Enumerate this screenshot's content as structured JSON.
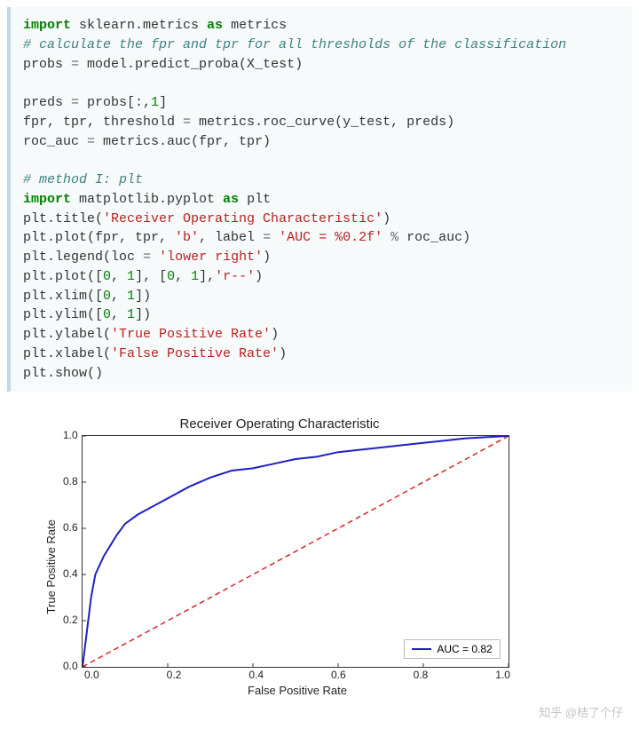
{
  "code": {
    "l1_kw": "import",
    "l1_rest": " sklearn.metrics ",
    "l1_as": "as",
    "l1_alias": " metrics",
    "l2": "# calculate the fpr and tpr for all thresholds of the classification",
    "l3a": "probs ",
    "l3op": "=",
    "l3b": " model.predict_proba(X_test)",
    "l5a": "preds ",
    "l5op": "=",
    "l5b": " probs[:,",
    "l5n": "1",
    "l5c": "]",
    "l6a": "fpr, tpr, threshold ",
    "l6op": "=",
    "l6b": " metrics.roc_curve(y_test, preds)",
    "l7a": "roc_auc ",
    "l7op": "=",
    "l7b": " metrics.auc(fpr, tpr)",
    "l9": "# method I: plt",
    "l10_kw": "import",
    "l10_rest": " matplotlib.pyplot ",
    "l10_as": "as",
    "l10_alias": " plt",
    "l11a": "plt.title(",
    "l11s": "'Receiver Operating Characteristic'",
    "l11c": ")",
    "l12a": "plt.plot(fpr, tpr, ",
    "l12s1": "'b'",
    "l12b": ", label ",
    "l12op": "=",
    "l12c": " ",
    "l12s2": "'AUC = %0.2f'",
    "l12d": " ",
    "l12pct": "%",
    "l12e": " roc_auc)",
    "l13a": "plt.legend(loc ",
    "l13op": "=",
    "l13b": " ",
    "l13s": "'lower right'",
    "l13c": ")",
    "l14a": "plt.plot([",
    "l14n1": "0",
    "l14b": ", ",
    "l14n2": "1",
    "l14c": "], [",
    "l14n3": "0",
    "l14d": ", ",
    "l14n4": "1",
    "l14e": "],",
    "l14s": "'r--'",
    "l14f": ")",
    "l15a": "plt.xlim([",
    "l15n1": "0",
    "l15b": ", ",
    "l15n2": "1",
    "l15c": "])",
    "l16a": "plt.ylim([",
    "l16n1": "0",
    "l16b": ", ",
    "l16n2": "1",
    "l16c": "])",
    "l17a": "plt.ylabel(",
    "l17s": "'True Positive Rate'",
    "l17c": ")",
    "l18a": "plt.xlabel(",
    "l18s": "'False Positive Rate'",
    "l18c": ")",
    "l19": "plt.show()"
  },
  "chart_data": {
    "type": "line",
    "title": "Receiver Operating Characteristic",
    "xlabel": "False Positive Rate",
    "ylabel": "True Positive Rate",
    "xlim": [
      0,
      1
    ],
    "ylim": [
      0,
      1
    ],
    "xticks": [
      "0.0",
      "0.2",
      "0.4",
      "0.6",
      "0.8",
      "1.0"
    ],
    "yticks": [
      "1.0",
      "0.8",
      "0.6",
      "0.4",
      "0.2",
      "0.0"
    ],
    "legend": "AUC = 0.82",
    "series": [
      {
        "name": "roc",
        "color": "#1f1fc7",
        "x": [
          0.0,
          0.01,
          0.02,
          0.03,
          0.05,
          0.08,
          0.1,
          0.13,
          0.17,
          0.2,
          0.25,
          0.3,
          0.35,
          0.4,
          0.45,
          0.5,
          0.55,
          0.6,
          0.65,
          0.7,
          0.75,
          0.8,
          0.85,
          0.9,
          0.95,
          1.0
        ],
        "y": [
          0.0,
          0.15,
          0.3,
          0.4,
          0.48,
          0.57,
          0.62,
          0.66,
          0.7,
          0.73,
          0.78,
          0.82,
          0.85,
          0.86,
          0.88,
          0.9,
          0.91,
          0.93,
          0.94,
          0.95,
          0.96,
          0.97,
          0.98,
          0.99,
          0.995,
          1.0
        ]
      },
      {
        "name": "diagonal",
        "color": "#d62728",
        "dash": true,
        "x": [
          0,
          1
        ],
        "y": [
          0,
          1
        ]
      }
    ]
  },
  "watermark": "知乎 @桔了个仔"
}
